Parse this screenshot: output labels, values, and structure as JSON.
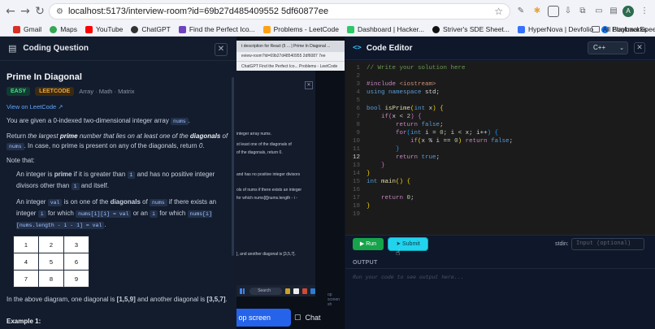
{
  "browser": {
    "url": "localhost:5173/interview-room?id=69b27d485409552 5df60877ee",
    "profile_initial": "A",
    "bookmarks": [
      {
        "label": "Gmail",
        "color": "#d93025"
      },
      {
        "label": "Maps",
        "color": "#34a853"
      },
      {
        "label": "YouTube",
        "color": "#ff0000"
      },
      {
        "label": "ChatGPT",
        "color": "#333333"
      },
      {
        "label": "Find the Perfect Ico...",
        "color": "#6f42c1"
      },
      {
        "label": "Problems - LeetCode",
        "color": "#ffa116"
      },
      {
        "label": "Dashboard | Hacker...",
        "color": "#2ec866"
      },
      {
        "label": "Striver's SDE Sheet...",
        "color": "#111111"
      },
      {
        "label": "HyperNova | Devfolio",
        "color": "#3770ff"
      },
      {
        "label": "PlaybackSpeed",
        "color": "#1a73e8"
      }
    ],
    "all_bookmarks": "All Bookmarks"
  },
  "question": {
    "panel_title": "Coding Question",
    "title": "Prime In Diagonal",
    "difficulty": "EASY",
    "source": "LEETCODE",
    "topics": "Array · Math · Matrix",
    "view_link": "View on LeetCode ↗",
    "p1_a": "You are given a 0-indexed two-dimensional integer array ",
    "p1_code": "nums",
    "p1_b": ".",
    "p2_a": "Return ",
    "p2_b1": "the largest ",
    "p2_b2": "prime",
    "p2_b3": " number that lies on at least one of the ",
    "p2_b4": "diagonals",
    "p2_b5": " of ",
    "p2_code": "nums",
    "p2_c": ". In case, no prime is present on any of the diagonals, return ",
    "p2_zero": "0",
    "p2_end": ".",
    "note": "Note that:",
    "b1_a": "An integer is ",
    "b1_prime": "prime",
    "b1_b": " if it is greater than ",
    "b1_code1": "1",
    "b1_c": " and has no positive integer divisors other than ",
    "b1_code2": "1",
    "b1_d": " and itself.",
    "b2_a": "An integer ",
    "b2_code1": "val",
    "b2_b": " is on one of the ",
    "b2_diag": "diagonals",
    "b2_c": " of ",
    "b2_code2": "nums",
    "b2_d": " if there exists an integer ",
    "b2_code3": "i",
    "b2_e": " for which ",
    "b2_code4": "nums[i][i] = val",
    "b2_f": " or an ",
    "b2_code5": "i",
    "b2_g": " for which ",
    "b2_code6": "nums[i][nums.length - i - 1] = val",
    "b2_h": ".",
    "grid": [
      [
        "1",
        "2",
        "3"
      ],
      [
        "4",
        "5",
        "6"
      ],
      [
        "7",
        "8",
        "9"
      ]
    ],
    "after_a": "In the above diagram, one diagonal is ",
    "after_d1": "[1,5,9]",
    "after_b": " and another diagonal is ",
    "after_d2": "[3,5,7]",
    "after_c": ".",
    "example": "Example 1:"
  },
  "video": {
    "tabs": "t description for React (5 ... | Prime In Diagonal ...",
    "url": "eview-room?id=69b27d48540955 2df6087 7ee",
    "bookmarks": "ChatGPT   Find the Perfect Ico...   Problems - LeetCode",
    "lines": [
      "integer array nums.",
      "st least one of the diagonals of",
      "of the diagonals, return 0.",
      "and has no positive integer divisors",
      "ols of nums if there exists an integer",
      "for which nums[i][nums.length - i -",
      "], and another diagonal is [3,5,7]."
    ],
    "taskbar_search": "Search",
    "share": "op screen share",
    "chat": "Chat",
    "partial": "op screen sh"
  },
  "editor": {
    "title": "Code Editor",
    "language": "C++",
    "lines": [
      {
        "n": "1",
        "html": "<span class='cm'>// Write your solution here</span>"
      },
      {
        "n": "2",
        "html": ""
      },
      {
        "n": "3",
        "html": "<span class='ctl'>#include</span> <span class='str'>&lt;iostream&gt;</span>"
      },
      {
        "n": "4",
        "html": "<span class='kw'>using namespace</span> std;"
      },
      {
        "n": "5",
        "html": ""
      },
      {
        "n": "6",
        "html": "<span class='kw'>bool</span> <span class='fn'>isPrime</span><span class='pu'>(</span><span class='kw'>int</span> x<span class='pu'>)</span> <span class='pu'>{</span>"
      },
      {
        "n": "7",
        "html": "    <span class='ctl'>if</span><span class='pu2'>(</span>x &lt; <span class='num'>2</span><span class='pu2'>)</span> <span class='pu2'>{</span>"
      },
      {
        "n": "8",
        "html": "        <span class='ctl'>return</span> <span class='kw'>false</span>;"
      },
      {
        "n": "9",
        "html": "        <span class='ctl'>for</span><span class='pu3'>(</span><span class='kw'>int</span> i = <span class='num'>0</span>; i &lt; x; i++<span class='pu3'>)</span> <span class='pu3'>{</span>"
      },
      {
        "n": "10",
        "html": "            <span class='ctl'>if</span><span class='pu'>(</span>x % i == <span class='num'>0</span><span class='pu'>)</span> <span class='ctl'>return</span> <span class='kw'>false</span>;"
      },
      {
        "n": "11",
        "html": "        <span class='pu3'>}</span>"
      },
      {
        "n": "12",
        "html": "        <span class='ctl'>return</span> <span class='kw'>true</span>;"
      },
      {
        "n": "13",
        "html": "    <span class='pu2'>}</span>"
      },
      {
        "n": "14",
        "html": "<span class='pu'>}</span>"
      },
      {
        "n": "15",
        "html": "<span class='kw'>int</span> <span class='fn'>main</span><span class='pu'>()</span> <span class='pu'>{</span>"
      },
      {
        "n": "16",
        "html": ""
      },
      {
        "n": "17",
        "html": "    <span class='ctl'>return</span> <span class='num'>0</span>;"
      },
      {
        "n": "18",
        "html": "<span class='pu'>}</span>"
      },
      {
        "n": "19",
        "html": ""
      }
    ],
    "current_line": "12",
    "run": "▶  Run",
    "submit": "➤  Submit",
    "stdin_label": "stdin:",
    "stdin_placeholder": "Input (optional)",
    "output_label": "OUTPUT",
    "output_placeholder": "Run your code to see output here..."
  }
}
